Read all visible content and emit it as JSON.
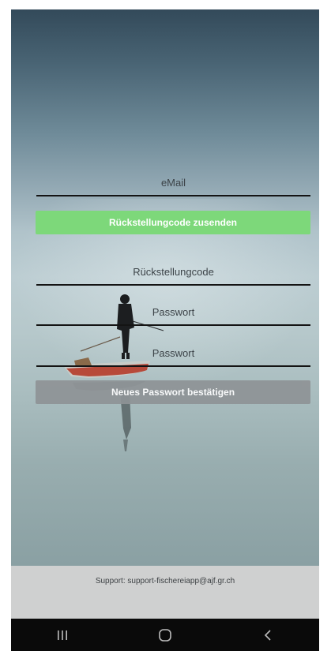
{
  "form": {
    "email_placeholder": "eMail",
    "send_code_label": "Rückstellungcode zusenden",
    "reset_code_placeholder": "Rückstellungcode",
    "password_placeholder": "Passwort",
    "password_repeat_placeholder": "Passwort",
    "confirm_label": "Neues Passwort bestätigen"
  },
  "footer": {
    "support_text": "Support: support-fischereiapp@ajf.gr.ch"
  },
  "system_nav": {
    "icons": [
      "recent-apps-icon",
      "home-icon",
      "back-icon"
    ]
  },
  "colors": {
    "primary_button": "#7dd87a",
    "disabled_button": "#8e9396",
    "footer_bg": "#cfd0d0",
    "navbar_bg": "#0a0a0a"
  }
}
